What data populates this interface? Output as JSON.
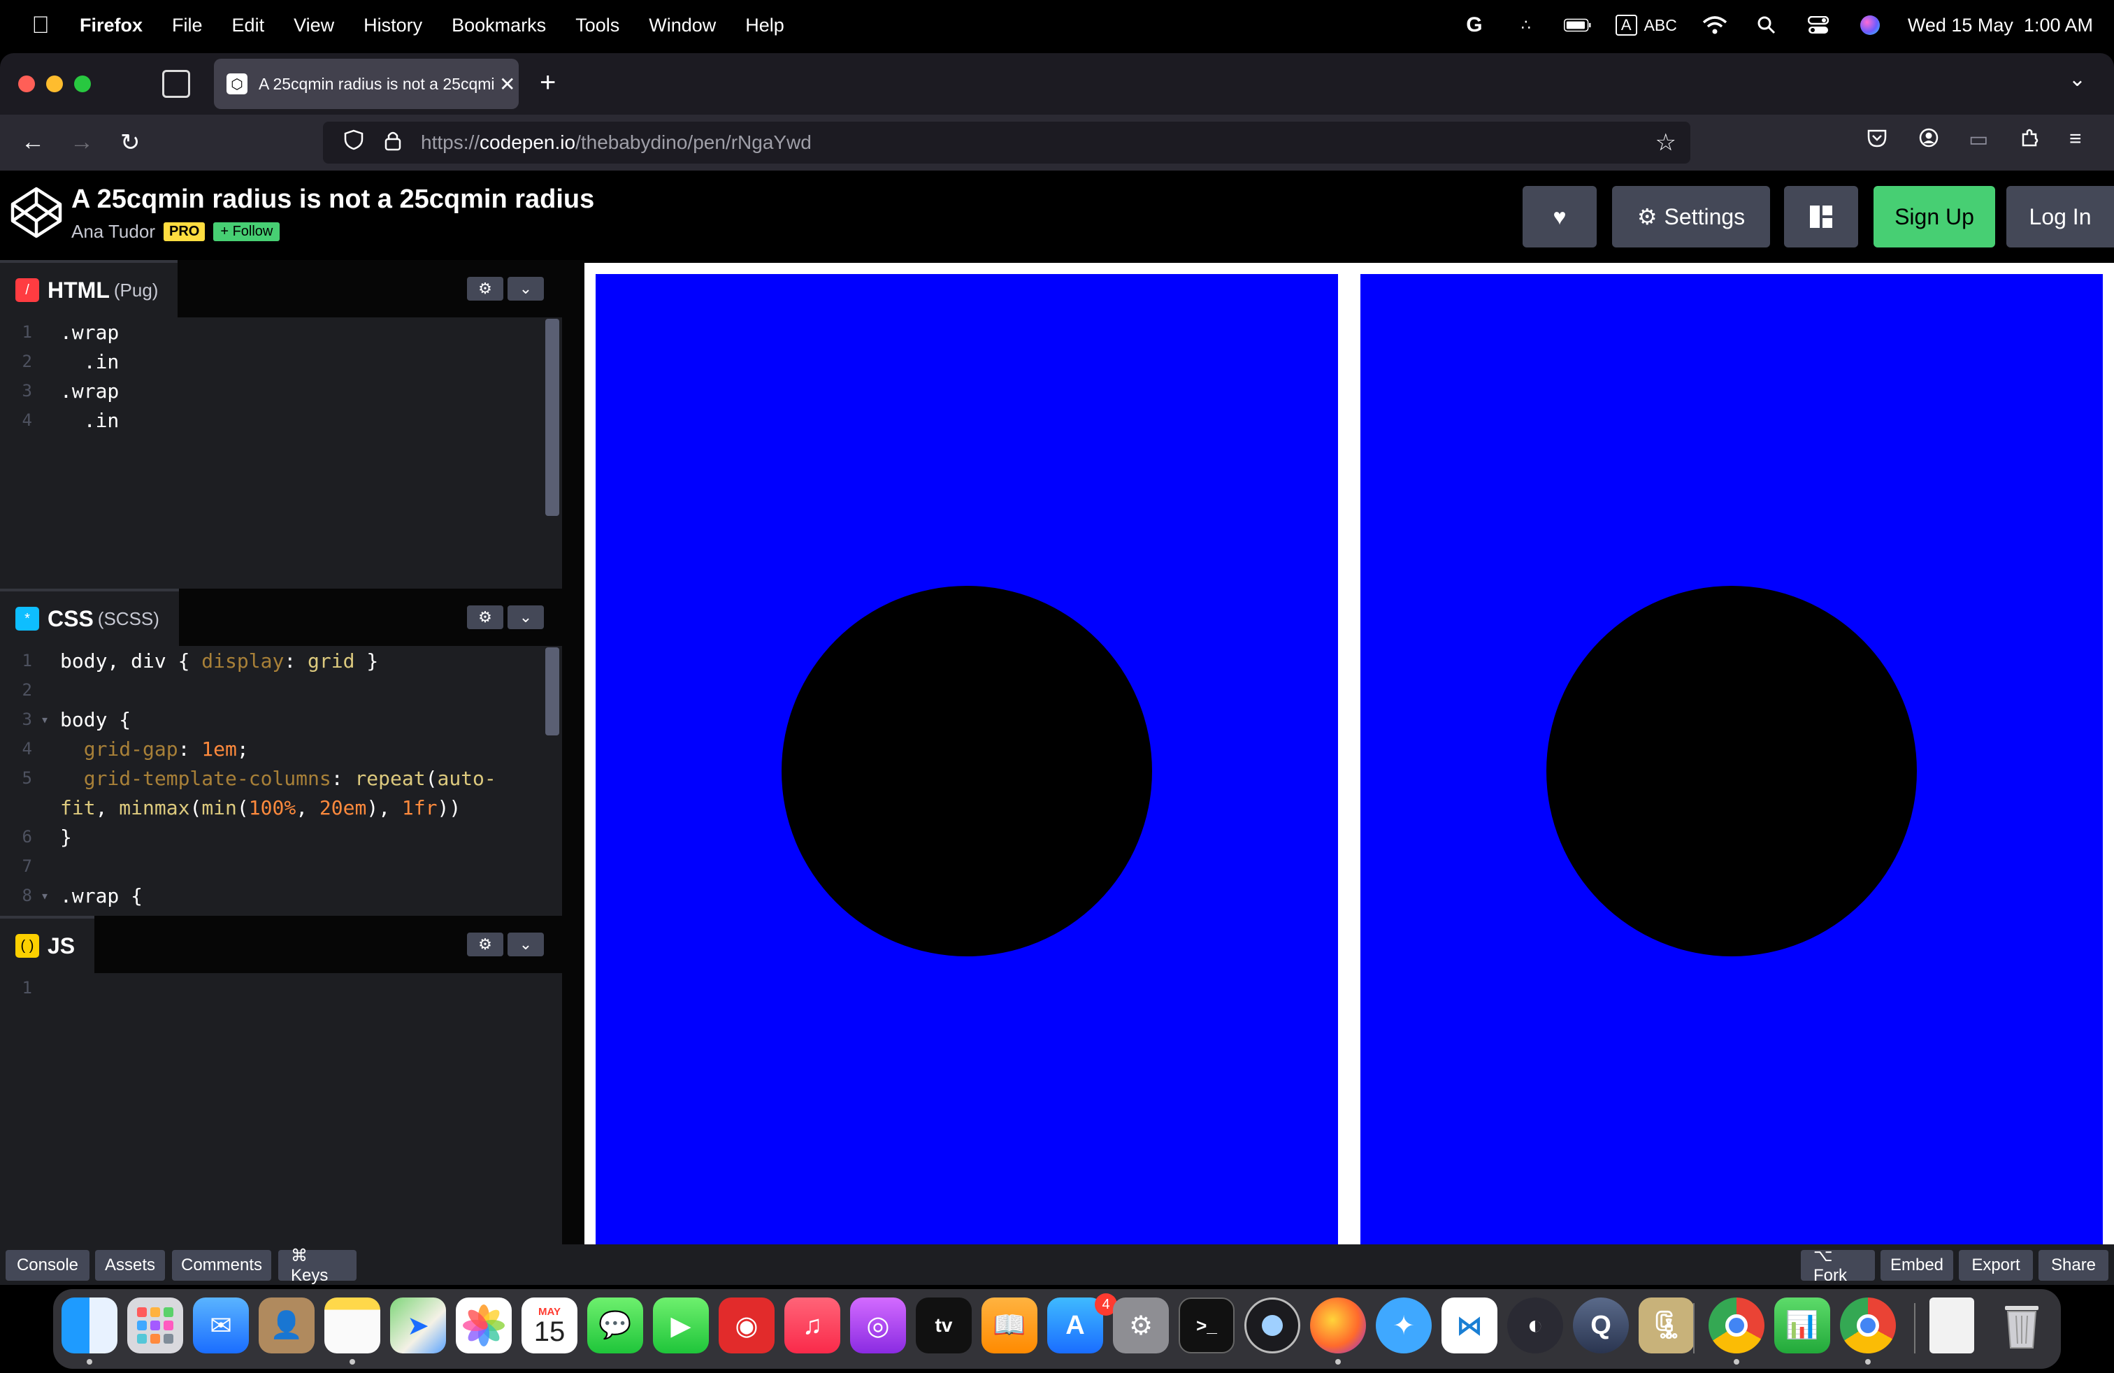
{
  "menubar": {
    "app": "Firefox",
    "items": [
      "File",
      "Edit",
      "View",
      "History",
      "Bookmarks",
      "Tools",
      "Window",
      "Help"
    ],
    "status_icons": [
      "google-icon",
      "dots-icon",
      "battery-icon",
      "input-a-icon",
      "wifi-icon",
      "spotlight-icon",
      "control-center-icon",
      "siri-icon"
    ],
    "input_label": "ABC",
    "clock": "Wed 15 May  1:00 AM"
  },
  "browser": {
    "tab_title": "A 25cqmin radius is not a 25cqmin radius",
    "url_scheme": "https://",
    "url_host": "codepen.io",
    "url_path": "/thebabydino/pen/rNgaYwd"
  },
  "codepen": {
    "title": "A 25cqmin radius is not a 25cqmin radius",
    "author": "Ana Tudor",
    "pro_badge": "PRO",
    "follow_label": "+ Follow",
    "settings_label": "Settings",
    "signup_label": "Sign Up",
    "login_label": "Log In"
  },
  "editors": {
    "html": {
      "label": "HTML",
      "preprocessor": "(Pug)",
      "lines": [
        ".wrap",
        "  .in",
        ".wrap",
        "  .in"
      ]
    },
    "css": {
      "label": "CSS",
      "preprocessor": "(SCSS)"
    },
    "js": {
      "label": "JS",
      "line1": "1"
    }
  },
  "bottom": {
    "left": [
      "Console",
      "Assets",
      "Comments",
      "⌘ Keys"
    ],
    "fork": "⌥ Fork",
    "embed": "Embed",
    "export": "Export",
    "share": "Share"
  },
  "dock": {
    "calendar_month": "MAY",
    "calendar_day": "15",
    "appstore_badge": "4",
    "tv_label": "tv"
  },
  "colors": {
    "preview_blue": "#0000ff",
    "codepen_green": "#47cf73",
    "pro_yellow": "#ffdd40"
  }
}
